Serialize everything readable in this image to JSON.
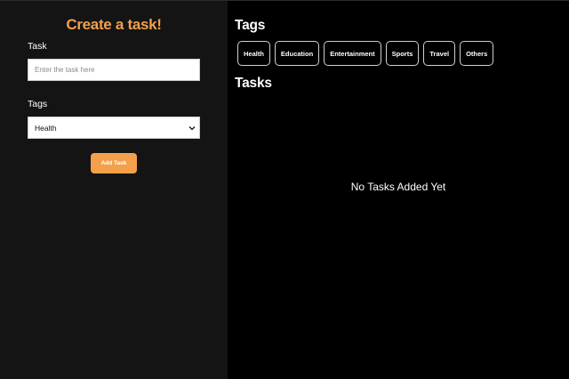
{
  "form": {
    "title": "Create a task!",
    "task_label": "Task",
    "task_placeholder": "Enter the task here",
    "task_value": "",
    "tags_label": "Tags",
    "tags_selected": "Health",
    "add_button_label": "Add Task"
  },
  "tags_section": {
    "heading": "Tags",
    "items": [
      {
        "label": "Health"
      },
      {
        "label": "Education"
      },
      {
        "label": "Entertainment"
      },
      {
        "label": "Sports"
      },
      {
        "label": "Travel"
      },
      {
        "label": "Others"
      }
    ]
  },
  "tasks_section": {
    "heading": "Tasks",
    "empty_message": "No Tasks Added Yet"
  },
  "colors": {
    "accent": "#f4a04a",
    "left_panel_bg": "#141414",
    "right_panel_bg": "#000000"
  }
}
